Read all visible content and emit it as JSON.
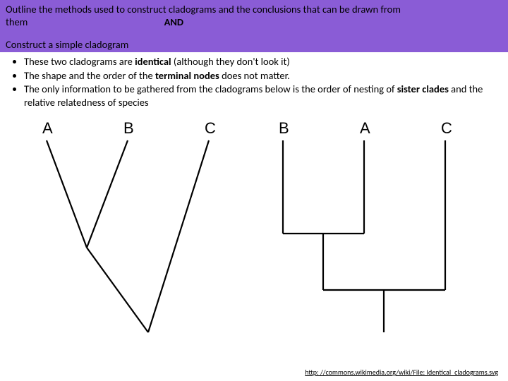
{
  "header": {
    "line1_a": "Outline the methods used to construct cladograms and the conclusions that can be drawn from",
    "line1_b": "them",
    "and": "AND",
    "line2": "Construct a simple cladogram"
  },
  "bullets": {
    "b1_pre": "These two cladograms are  ",
    "b1_bold": "identical",
    "b1_post": " (although they don't look it)",
    "b2_pre": "The shape and the order of the ",
    "b2_bold": "terminal nodes",
    "b2_post": "  does not matter.",
    "b3_pre": "The only information to be gathered from the cladograms below is the order of nesting of ",
    "b3_bold": "sister clades",
    "b3_post": "  and the relative relatedness of species"
  },
  "diagram": {
    "left": {
      "a": "A",
      "b": "B",
      "c": "C"
    },
    "right": {
      "a": "A",
      "b": "B",
      "c": "C"
    }
  },
  "footer": {
    "url": "http: //commons.wikimedia.org/wiki/File: Identical_cladograms.svg"
  }
}
